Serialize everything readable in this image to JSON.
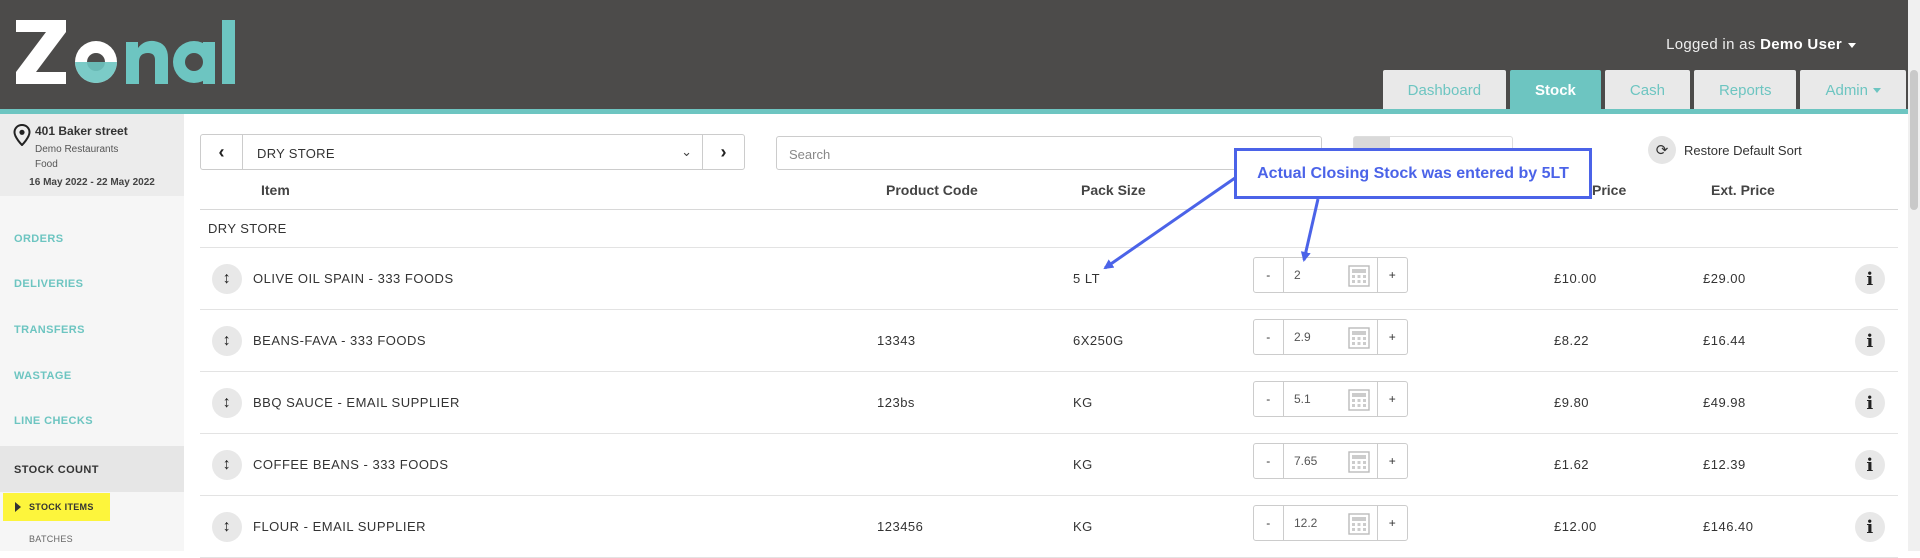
{
  "app": {
    "logo_text": "Zonal",
    "logged_in_prefix": "Logged in as",
    "user_name": "Demo User",
    "brand_color": "#6dc5c1",
    "header_color": "#4c4b4a"
  },
  "nav": {
    "tabs": [
      {
        "label": "Dashboard"
      },
      {
        "label": "Stock"
      },
      {
        "label": "Cash"
      },
      {
        "label": "Reports"
      },
      {
        "label": "Admin"
      }
    ],
    "active": "Stock"
  },
  "site": {
    "address": "401 Baker street",
    "org_line1": "Demo Restaurants",
    "org_line2": "Food",
    "date_range": "16 May 2022 - 22 May 2022"
  },
  "sidebar": {
    "items": [
      {
        "label": "ORDERS"
      },
      {
        "label": "DELIVERIES"
      },
      {
        "label": "TRANSFERS"
      },
      {
        "label": "WASTAGE"
      },
      {
        "label": "LINE CHECKS"
      }
    ],
    "active_item": "STOCK COUNT",
    "sub_items": [
      {
        "label": "STOCK ITEMS"
      },
      {
        "label": "BATCHES"
      }
    ]
  },
  "toolbar": {
    "location_value": "DRY STORE",
    "search_placeholder": "Search",
    "restore_label": "Restore Default Sort"
  },
  "table": {
    "headers": {
      "item": "Item",
      "code": "Product Code",
      "pack": "Pack Size",
      "price": "Price",
      "ext": "Ext. Price"
    },
    "group": "DRY STORE",
    "rows": [
      {
        "name": "OLIVE OIL SPAIN - 333 FOODS",
        "code": "",
        "pack": "5 LT",
        "qty": "2",
        "price": "£10.00",
        "ext": "£29.00"
      },
      {
        "name": "BEANS-FAVA - 333 FOODS",
        "code": "13343",
        "pack": "6X250G",
        "qty": "2.9",
        "price": "£8.22",
        "ext": "£16.44"
      },
      {
        "name": "BBQ SAUCE - EMAIL SUPPLIER",
        "code": "123bs",
        "pack": "KG",
        "qty": "5.1",
        "price": "£9.80",
        "ext": "£49.98"
      },
      {
        "name": "COFFEE BEANS - 333 FOODS",
        "code": "",
        "pack": "KG",
        "qty": "7.65",
        "price": "£1.62",
        "ext": "£12.39"
      },
      {
        "name": "FLOUR - EMAIL SUPPLIER",
        "code": "123456",
        "pack": "KG",
        "qty": "12.2",
        "price": "£12.00",
        "ext": "£146.40"
      }
    ]
  },
  "annotation": {
    "text": "Actual Closing Stock was entered by 5LT",
    "color": "#4b63e8"
  }
}
